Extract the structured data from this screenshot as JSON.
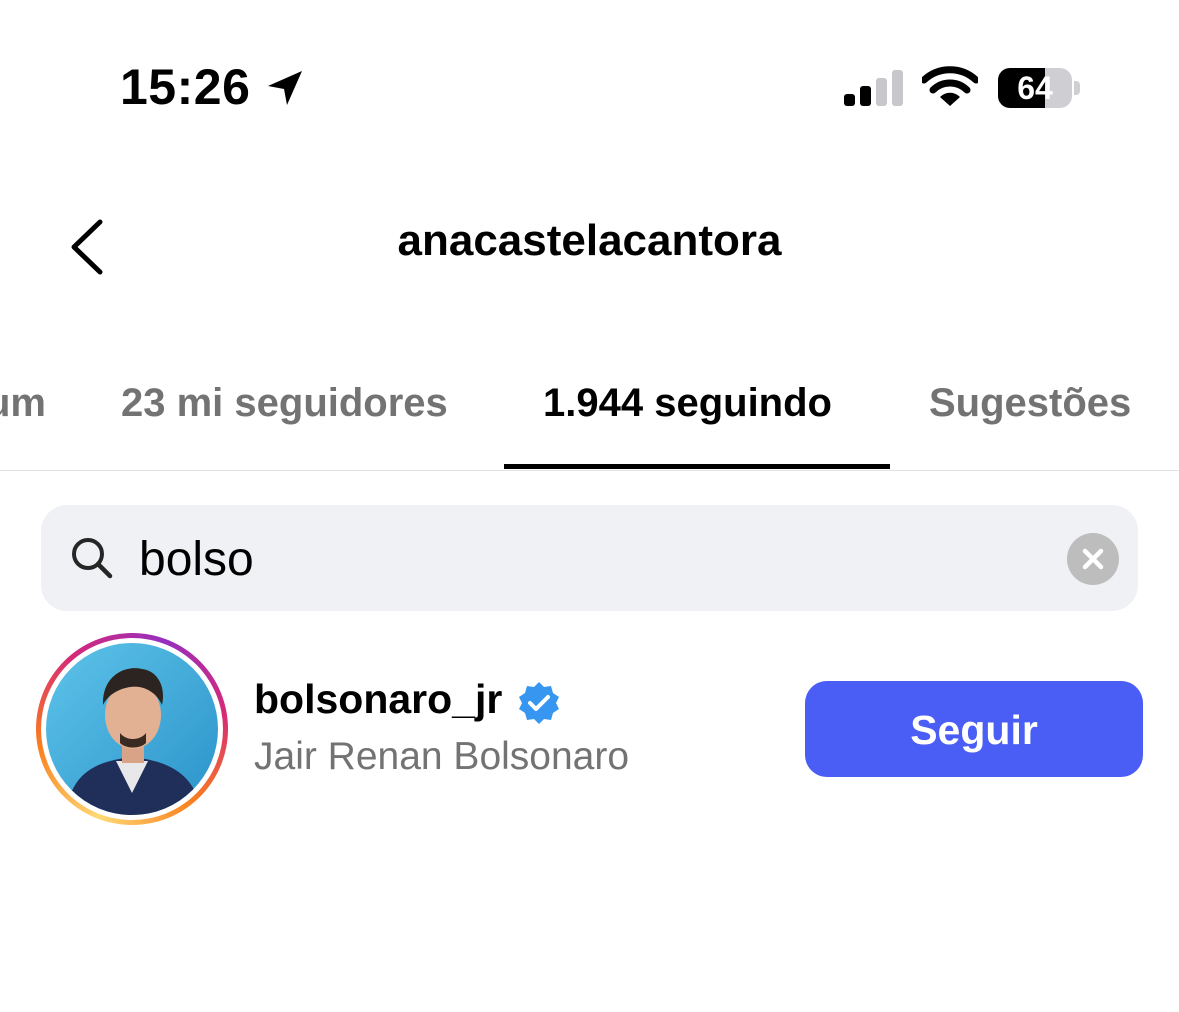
{
  "status_bar": {
    "time": "15:26",
    "battery_percent": "64",
    "battery_level": 0.64,
    "icons": [
      "location-arrow-icon",
      "cellular-signal-icon",
      "wifi-icon",
      "battery-icon"
    ]
  },
  "header": {
    "title": "anacastelacantora",
    "back_icon": "chevron-left-icon"
  },
  "tabs": [
    {
      "label": "um",
      "active": false
    },
    {
      "label": "23 mi seguidores",
      "active": false
    },
    {
      "label": "1.944 seguindo",
      "active": true
    },
    {
      "label": "Sugestões",
      "active": false
    }
  ],
  "search": {
    "value": "bolso",
    "icon": "search-icon",
    "clear_icon": "clear-icon"
  },
  "results": [
    {
      "username": "bolsonaro_jr",
      "full_name": "Jair Renan Bolsonaro",
      "verified": true,
      "has_story": true,
      "follow_label": "Seguir"
    }
  ],
  "colors": {
    "accent": "#4a5df5",
    "verified": "#3797f0",
    "secondary_text": "#737373",
    "search_background": "#eff1f4"
  }
}
